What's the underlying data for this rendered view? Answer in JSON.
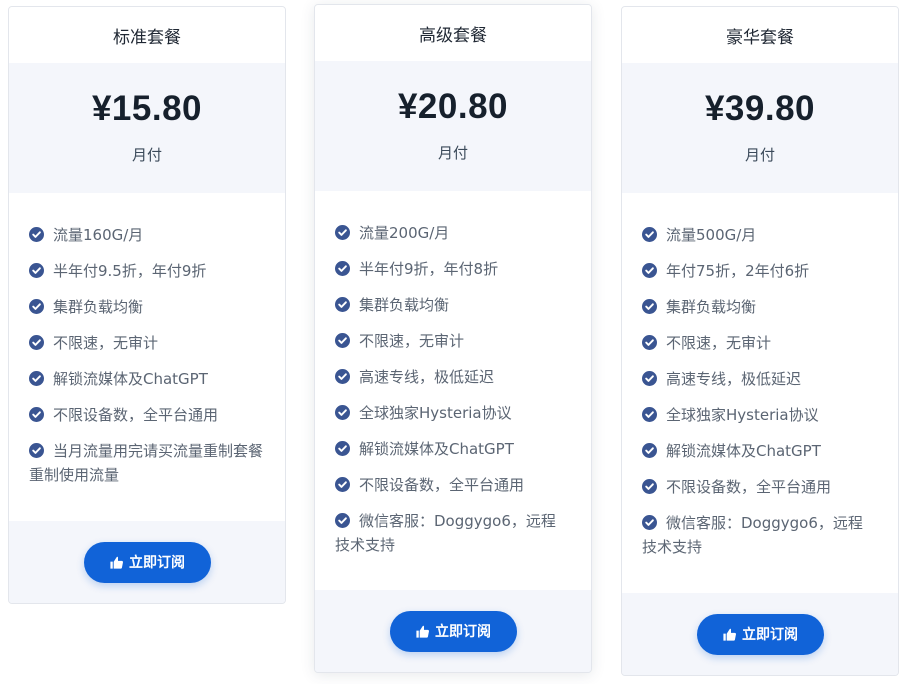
{
  "plans": [
    {
      "name": "标准套餐",
      "price": "¥15.80",
      "period": "月付",
      "features": [
        "流量160G/月",
        "半年付9.5折，年付9折",
        "集群负载均衡",
        "不限速，无审计",
        "解锁流媒体及ChatGPT",
        "不限设备数，全平台通用",
        "当月流量用完请买流量重制套餐重制使用流量"
      ],
      "button": "立即订阅"
    },
    {
      "name": "高级套餐",
      "price": "¥20.80",
      "period": "月付",
      "features": [
        "流量200G/月",
        "半年付9折，年付8折",
        "集群负载均衡",
        "不限速，无审计",
        "高速专线，极低延迟",
        "全球独家Hysteria协议",
        "解锁流媒体及ChatGPT",
        "不限设备数，全平台通用",
        "微信客服：Doggygo6，远程技术支持"
      ],
      "button": "立即订阅"
    },
    {
      "name": "豪华套餐",
      "price": "¥39.80",
      "period": "月付",
      "features": [
        "流量500G/月",
        "年付75折，2年付6折",
        "集群负载均衡",
        "不限速，无审计",
        "高速专线，极低延迟",
        "全球独家Hysteria协议",
        "解锁流媒体及ChatGPT",
        "不限设备数，全平台通用",
        "微信客服：Doggygo6，远程技术支持"
      ],
      "button": "立即订阅"
    }
  ],
  "colors": {
    "accent": "#1163d8",
    "check": "#3a5592",
    "panel": "#f4f6fb"
  },
  "icons": {
    "feature": "check-circle-icon",
    "button": "thumbs-up-icon"
  }
}
